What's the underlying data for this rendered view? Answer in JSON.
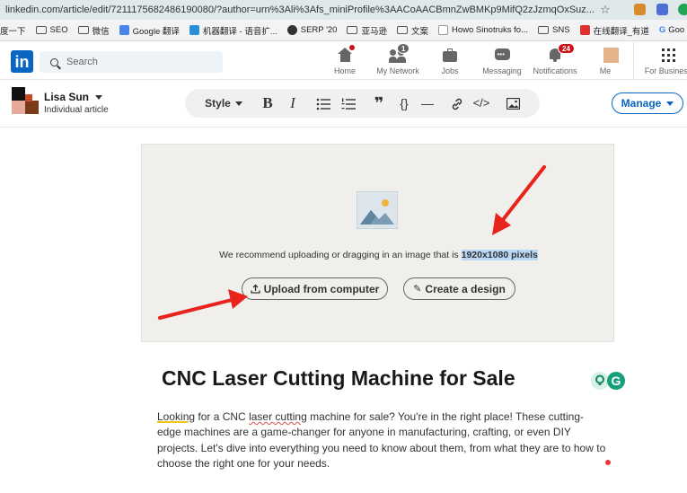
{
  "browser": {
    "url": "linkedin.com/article/edit/7211175682486190080/?author=urn%3Ali%3Afs_miniProfile%3AACoAACBmnZwBMKp9MifQ2zJzmqOxSuz...",
    "bookmarks": [
      {
        "label": "度一下",
        "kind": "text"
      },
      {
        "label": "SEO",
        "kind": "folder"
      },
      {
        "label": "微信",
        "kind": "folder"
      },
      {
        "label": "Google 翻译",
        "kind": "translate"
      },
      {
        "label": "机器翻译 - 语音扩...",
        "kind": "translate"
      },
      {
        "label": "SERP '20",
        "kind": "globe"
      },
      {
        "label": "亚马逊",
        "kind": "folder"
      },
      {
        "label": "文案",
        "kind": "folder"
      },
      {
        "label": "Howo Sinotruks fo...",
        "kind": "page"
      },
      {
        "label": "SNS",
        "kind": "folder"
      },
      {
        "label": "在线翻译_有道",
        "kind": "youdao"
      },
      {
        "label": "Goo",
        "kind": "google"
      }
    ]
  },
  "nav": {
    "logo": "in",
    "search_placeholder": "Search",
    "items": [
      {
        "label": "Home",
        "icon": "home-icon",
        "badge": ""
      },
      {
        "label": "My Network",
        "icon": "network-icon",
        "badge": "1"
      },
      {
        "label": "Jobs",
        "icon": "jobs-icon",
        "badge": ""
      },
      {
        "label": "Messaging",
        "icon": "messaging-icon",
        "badge": ""
      },
      {
        "label": "Notifications",
        "icon": "bell-icon",
        "badge": "24"
      },
      {
        "label": "Me",
        "icon": "avatar-icon",
        "badge": ""
      },
      {
        "label": "For Business",
        "icon": "grid-icon",
        "badge": ""
      }
    ]
  },
  "editor": {
    "author_name": "Lisa Sun",
    "author_sub": "Individual article",
    "toolbar": {
      "style_label": "Style",
      "bold": "B",
      "italic": "I",
      "quote": "❞",
      "code_braces": "{}",
      "divider": "—",
      "embed": "</>"
    },
    "manage_label": "Manage"
  },
  "upload": {
    "message_prefix": "We recommend uploading or dragging in an image that is ",
    "message_highlight": "1920x1080 pixels",
    "upload_button": "Upload from computer",
    "design_button": "Create a design"
  },
  "article": {
    "title": "CNC Laser Cutting Machine for Sale",
    "body_w1": "Looking",
    "body_w2": " for a CNC ",
    "body_w3": "laser cutting",
    "body_w4": " machine for sale? You're in the right place! These cutting-edge machines are a game-changer for anyone in manufacturing, crafting, or even DIY projects. Let's dive into everything you need to know about them, from what they are to how to choose the right one for your needs."
  },
  "colors": {
    "linkedin_blue": "#0a66c2",
    "badge_red": "#cc1016",
    "annotation_red": "#e8231b",
    "highlight_blue": "#b9d7f6"
  }
}
